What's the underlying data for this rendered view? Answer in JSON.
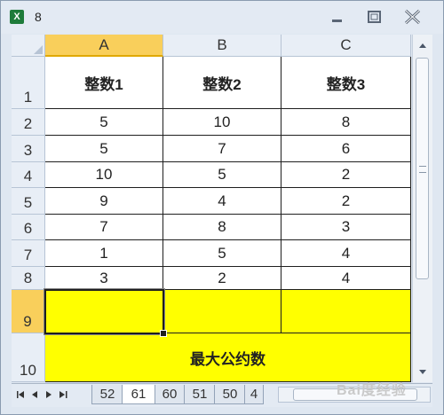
{
  "window": {
    "title": "8",
    "app_icon_letter": "X"
  },
  "columns": [
    "A",
    "B",
    "C"
  ],
  "rows": [
    "1",
    "2",
    "3",
    "4",
    "5",
    "6",
    "7",
    "8",
    "9",
    "10"
  ],
  "cells": {
    "header": [
      "整数1",
      "整数2",
      "整数3"
    ],
    "data": [
      [
        "5",
        "10",
        "8"
      ],
      [
        "5",
        "7",
        "6"
      ],
      [
        "10",
        "5",
        "2"
      ],
      [
        "9",
        "4",
        "2"
      ],
      [
        "7",
        "8",
        "3"
      ],
      [
        "1",
        "5",
        "4"
      ],
      [
        "3",
        "2",
        "4"
      ]
    ],
    "merged_row10": "最大公约数"
  },
  "selection": {
    "active_cell": "A9",
    "highlight_color": "#ffff00"
  },
  "sheet_tabs": [
    "52",
    "61",
    "60",
    "51",
    "50",
    "4"
  ],
  "active_sheet": "61",
  "watermark": "Bai度经验"
}
